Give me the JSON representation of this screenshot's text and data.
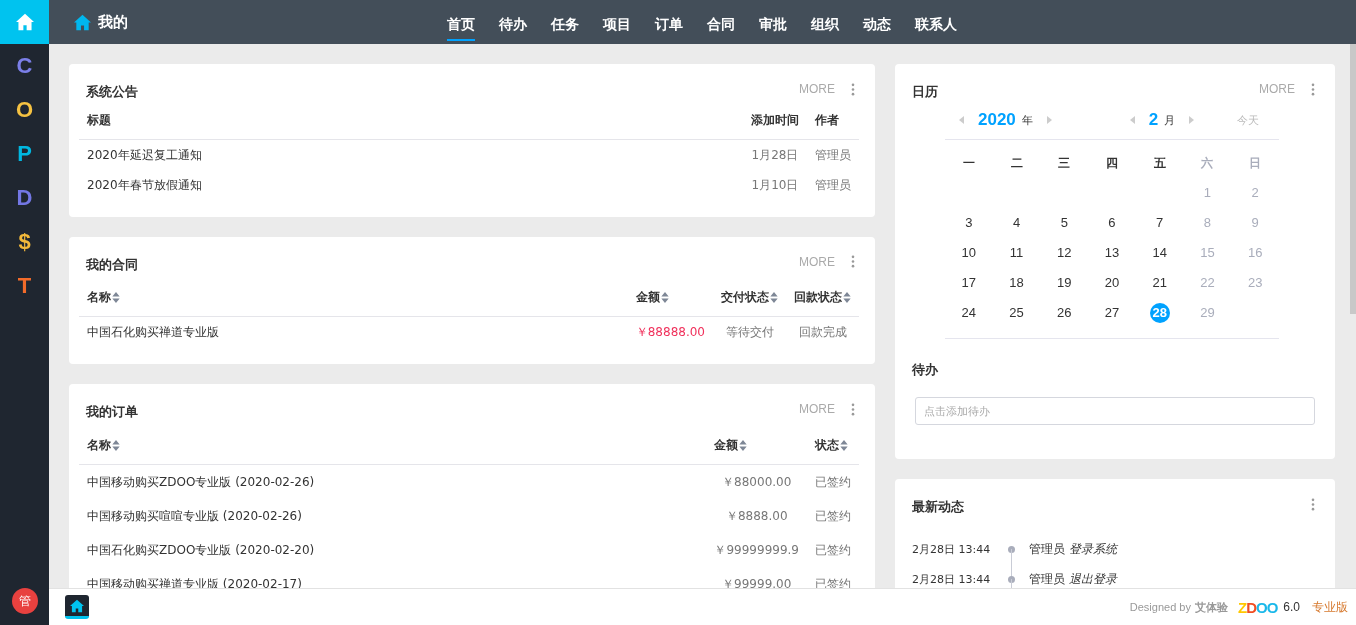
{
  "sidebar": {
    "items": [
      {
        "kind": "home",
        "selected": true
      },
      {
        "kind": "letter",
        "label": "C",
        "color": "#7b7fe8",
        "selected": false
      },
      {
        "kind": "letter",
        "label": "O",
        "color": "#f5c242",
        "selected": false
      },
      {
        "kind": "letter",
        "label": "P",
        "color": "#00b7e0",
        "selected": false
      },
      {
        "kind": "letter",
        "label": "D",
        "color": "#7377e4",
        "selected": false
      },
      {
        "kind": "letter",
        "label": "$",
        "color": "#f3b93a",
        "selected": false
      },
      {
        "kind": "letter",
        "label": "T",
        "color": "#f26b2a",
        "selected": false
      }
    ],
    "avatar": "管"
  },
  "header": {
    "title": "我的",
    "tabs": [
      {
        "label": "首页",
        "selected": true
      },
      {
        "label": "待办",
        "selected": false
      },
      {
        "label": "任务",
        "selected": false
      },
      {
        "label": "项目",
        "selected": false
      },
      {
        "label": "订单",
        "selected": false
      },
      {
        "label": "合同",
        "selected": false
      },
      {
        "label": "审批",
        "selected": false
      },
      {
        "label": "组织",
        "selected": false
      },
      {
        "label": "动态",
        "selected": false
      },
      {
        "label": "联系人",
        "selected": false
      }
    ]
  },
  "panels": [
    {
      "title": "系统公告",
      "more": "MORE",
      "columns": [
        {
          "label": "标题",
          "sortable": false
        },
        {
          "label": "添加时间",
          "sortable": false
        },
        {
          "label": "作者",
          "sortable": false
        }
      ],
      "rows": [
        [
          "2020年延迟复工通知",
          "1月28日",
          "管理员"
        ],
        [
          "2020年春节放假通知",
          "1月10日",
          "管理员"
        ]
      ]
    },
    {
      "title": "我的合同",
      "more": "MORE",
      "columns": [
        {
          "label": "名称",
          "sortable": true
        },
        {
          "label": "金额",
          "sortable": true
        },
        {
          "label": "交付状态",
          "sortable": true
        },
        {
          "label": "回款状态",
          "sortable": true
        }
      ],
      "rows": [
        [
          "中国石化购买禅道专业版",
          "￥88888.00",
          "等待交付",
          "回款完成"
        ]
      ]
    },
    {
      "title": "我的订单",
      "more": "MORE",
      "columns": [
        {
          "label": "名称",
          "sortable": true
        },
        {
          "label": "金额",
          "sortable": true
        },
        {
          "label": "状态",
          "sortable": true
        }
      ],
      "rows": [
        [
          "中国移动购买ZDOO专业版 (2020-02-26)",
          "￥88000.00",
          "已签约"
        ],
        [
          "中国移动购买喧喧专业版 (2020-02-26)",
          "￥8888.00",
          "已签约"
        ],
        [
          "中国石化购买ZDOO专业版 (2020-02-20)",
          "￥99999999.9",
          "已签约"
        ],
        [
          "中国移动购买禅道专业版 (2020-02-17)",
          "￥99999.00",
          "已签约"
        ]
      ]
    }
  ],
  "calendar": {
    "title": "日历",
    "more": "MORE",
    "year": "2020",
    "year_unit": "年",
    "month": "2",
    "month_unit": "月",
    "today": "今天",
    "weekdays": [
      {
        "label": "一",
        "weekend": false
      },
      {
        "label": "二",
        "weekend": false
      },
      {
        "label": "三",
        "weekend": false
      },
      {
        "label": "四",
        "weekend": false
      },
      {
        "label": "五",
        "weekend": false
      },
      {
        "label": "六",
        "weekend": true
      },
      {
        "label": "日",
        "weekend": true
      }
    ],
    "weeks": [
      [
        {
          "day": "1",
          "weekend": true,
          "selected": false
        },
        {
          "day": "2",
          "weekend": true,
          "selected": false
        }
      ],
      [
        {
          "day": "3",
          "weekend": false,
          "selected": false
        },
        {
          "day": "4",
          "weekend": false,
          "selected": false
        },
        {
          "day": "5",
          "weekend": false,
          "selected": false
        },
        {
          "day": "6",
          "weekend": false,
          "selected": false
        },
        {
          "day": "7",
          "weekend": false,
          "selected": false
        },
        {
          "day": "8",
          "weekend": true,
          "selected": false
        },
        {
          "day": "9",
          "weekend": true,
          "selected": false
        }
      ],
      [
        {
          "day": "10",
          "weekend": false,
          "selected": false
        },
        {
          "day": "11",
          "weekend": false,
          "selected": false
        },
        {
          "day": "12",
          "weekend": false,
          "selected": false
        },
        {
          "day": "13",
          "weekend": false,
          "selected": false
        },
        {
          "day": "14",
          "weekend": false,
          "selected": false
        },
        {
          "day": "15",
          "weekend": true,
          "selected": false
        },
        {
          "day": "16",
          "weekend": true,
          "selected": false
        }
      ],
      [
        {
          "day": "17",
          "weekend": false,
          "selected": false
        },
        {
          "day": "18",
          "weekend": false,
          "selected": false
        },
        {
          "day": "19",
          "weekend": false,
          "selected": false
        },
        {
          "day": "20",
          "weekend": false,
          "selected": false
        },
        {
          "day": "21",
          "weekend": false,
          "selected": false
        },
        {
          "day": "22",
          "weekend": true,
          "selected": false
        },
        {
          "day": "23",
          "weekend": true,
          "selected": false
        }
      ],
      [
        {
          "day": "24",
          "weekend": false,
          "selected": false
        },
        {
          "day": "25",
          "weekend": false,
          "selected": false
        },
        {
          "day": "26",
          "weekend": false,
          "selected": false
        },
        {
          "day": "27",
          "weekend": false,
          "selected": false
        },
        {
          "day": "28",
          "weekend": false,
          "selected": true
        },
        {
          "day": "29",
          "weekend": true,
          "selected": false
        }
      ]
    ],
    "todo": {
      "title": "待办",
      "placeholder": "点击添加待办"
    }
  },
  "activity": {
    "title": "最新动态",
    "items": [
      {
        "time": "2月28日 13:44",
        "text": "管理员 *登录系统*"
      },
      {
        "time": "2月28日 13:44",
        "text": "管理员 *退出登录*"
      }
    ]
  },
  "footer": {
    "designed_by": "Designed by",
    "designer": "艾体验",
    "logo": "ZDOO",
    "version": "6.0",
    "edition": "专业版"
  }
}
